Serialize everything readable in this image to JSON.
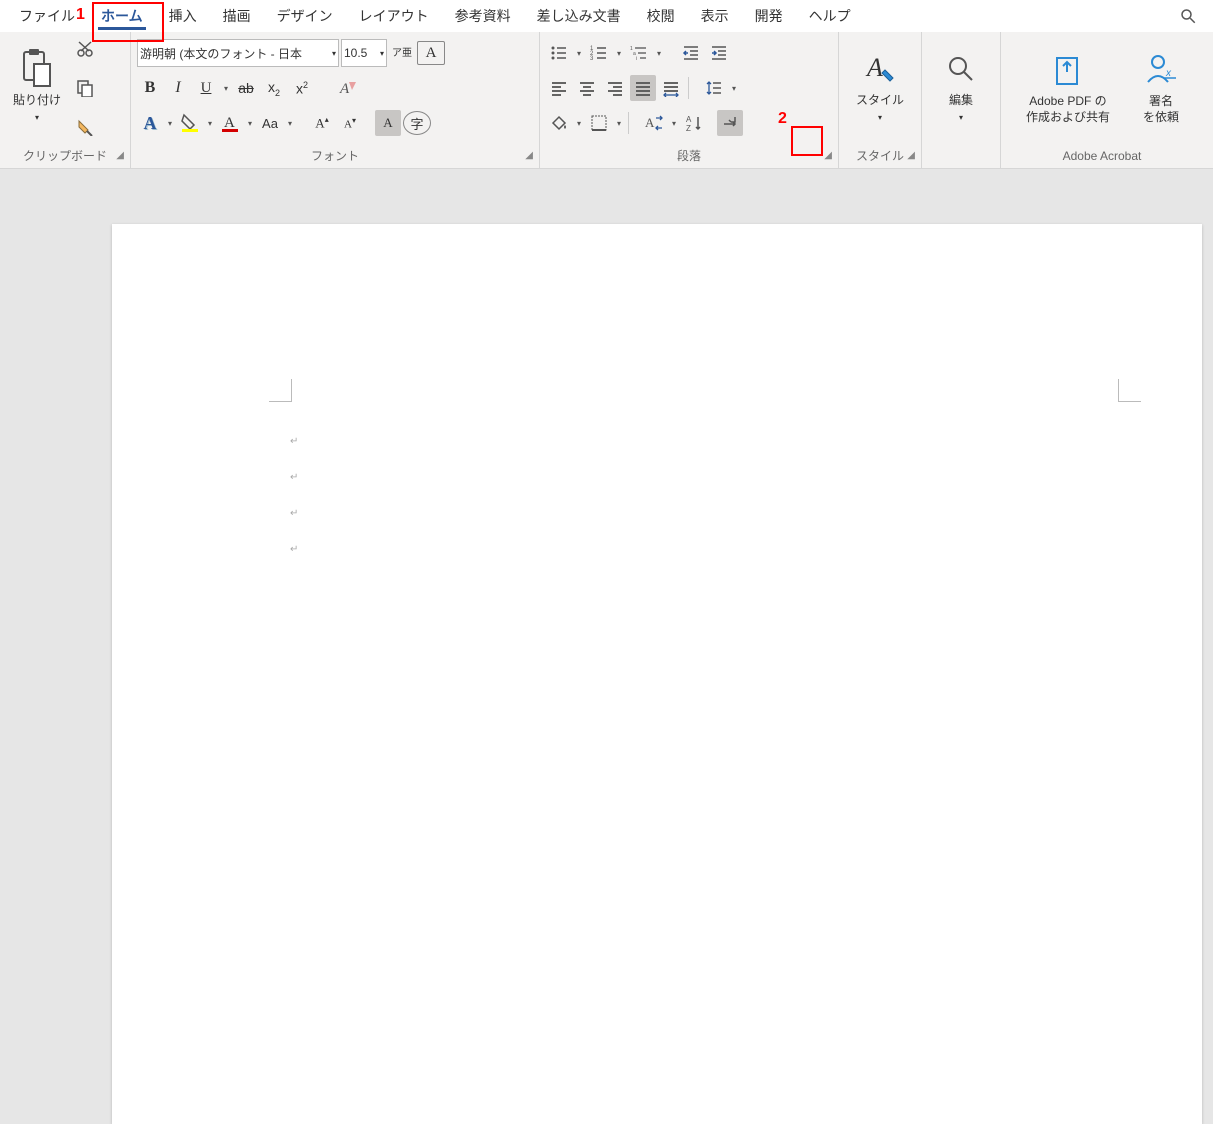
{
  "tabs": {
    "file": "ファイル",
    "home": "ホーム",
    "insert": "挿入",
    "draw": "描画",
    "design": "デザイン",
    "layout": "レイアウト",
    "references": "参考資料",
    "mailings": "差し込み文書",
    "review": "校閲",
    "view": "表示",
    "developer": "開発",
    "help": "ヘルプ"
  },
  "annotations": {
    "home_tab": "1",
    "show_marks": "2"
  },
  "clipboard": {
    "paste": "貼り付け",
    "group": "クリップボード"
  },
  "font": {
    "name": "游明朝 (本文のフォント - 日本",
    "size": "10.5",
    "ruby": "ア亜",
    "aa": "Aa",
    "group": "フォント"
  },
  "paragraph": {
    "group": "段落"
  },
  "styles": {
    "label": "スタイル",
    "group": "スタイル"
  },
  "editing": {
    "label": "編集"
  },
  "acrobat": {
    "pdf1": "Adobe PDF の",
    "pdf2": "作成および共有",
    "sign1": "署名",
    "sign2": "を依頼",
    "group": "Adobe Acrobat"
  },
  "doc": {
    "paragraph_mark": "↵"
  }
}
